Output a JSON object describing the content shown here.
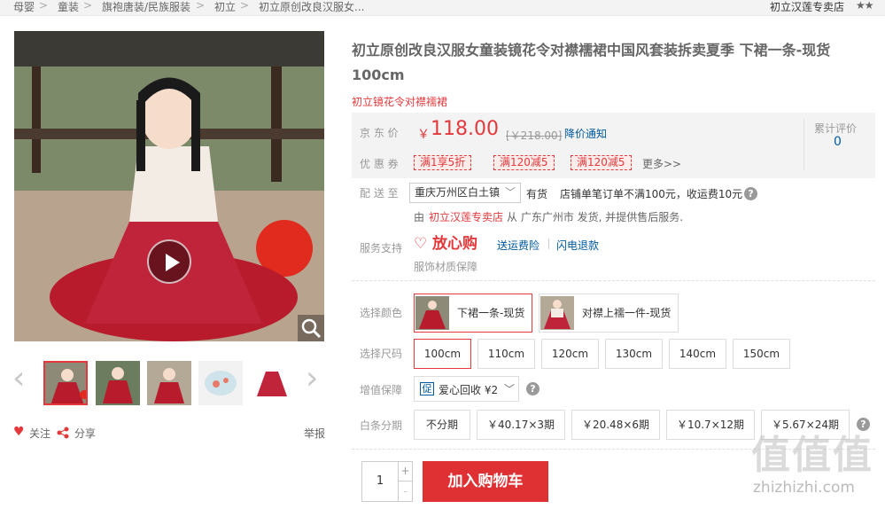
{
  "breadcrumb": {
    "items": [
      "母婴",
      "童装",
      "旗袍唐装/民族服装",
      "初立",
      "初立原创改良汉服女..."
    ],
    "seps": [
      ">",
      ">",
      ">",
      ">"
    ],
    "store": "初立汉莲专卖店"
  },
  "product": {
    "title_line1": "初立原创改良汉服女童装镜花令对襟襦裙中国风套装拆卖夏季 下裙一条-现货",
    "title_line2": "100cm",
    "subtitle": "初立镜花令对襟襦裙"
  },
  "price": {
    "label": "京 东 价",
    "currency": "￥",
    "value": "118.00",
    "original": "[￥218.00]",
    "notify": "降价通知",
    "review_label": "累计评价",
    "review_count": "0"
  },
  "coupons": {
    "label": "优 惠 券",
    "items": [
      "满1享5折",
      "满120减5",
      "满120减5"
    ],
    "more": "更多>>"
  },
  "delivery": {
    "label": "配 送 至",
    "location": "重庆万州区白土镇",
    "stock": "有货",
    "shipping": "店铺单笔订单不满100元，收运费10元",
    "from_prefix": "由",
    "seller": "初立汉莲专卖店",
    "from_suffix": "从 广东广州市 发货, 并提供售后服务."
  },
  "service": {
    "label": "服务支持",
    "brand": "放心购",
    "items": [
      "送运费险",
      "闪电退款"
    ],
    "note": "服饰材质保障"
  },
  "color": {
    "label": "选择颜色",
    "options": [
      "下裙一条-现货",
      "对襟上襦一件-现货"
    ],
    "selected": 0
  },
  "size": {
    "label": "选择尺码",
    "options": [
      "100cm",
      "110cm",
      "120cm",
      "130cm",
      "140cm",
      "150cm"
    ],
    "selected": 0
  },
  "addon": {
    "label": "增值保障",
    "badge": "促",
    "text": "爱心回收 ¥2"
  },
  "installment": {
    "label": "白条分期",
    "options": [
      "不分期",
      "￥40.17×3期",
      "￥20.48×6期",
      "￥10.7×12期",
      "￥5.67×24期"
    ]
  },
  "cart": {
    "quantity": "1",
    "plus": "+",
    "minus": "-",
    "button": "加入购物车"
  },
  "gallery": {
    "follow": "关注",
    "share": "分享",
    "report": "举报",
    "prev": "‹",
    "next": "›"
  },
  "watermark": {
    "site": "zhizhizhi.com"
  },
  "colors": {
    "accent": "#e4393c",
    "price": "#e4393c"
  }
}
